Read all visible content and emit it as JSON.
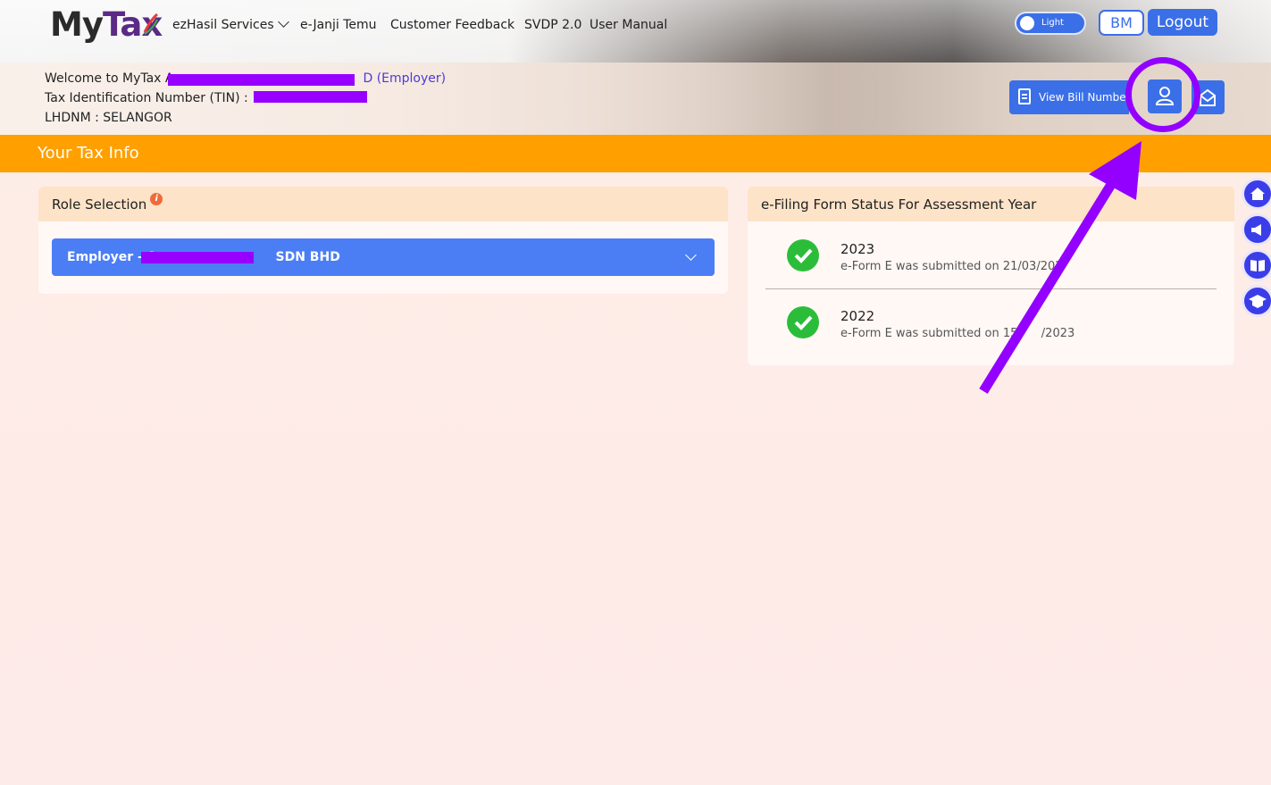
{
  "header": {
    "logo_text_1": "My",
    "logo_text_2": "Tax",
    "nav": [
      "ezHasil Services",
      "e-Janji Temu",
      "Customer Feedback",
      "SVDP 2.0",
      "User Manual"
    ],
    "theme_toggle_label": "Light",
    "lang_button": "BM",
    "logout_button": "Logout"
  },
  "welcome": {
    "line1_prefix": "Welcome to MyTax A",
    "line1_suffix": "D (Employer)",
    "line2": "Tax Identification Number (TIN) : ",
    "line3": "LHDNM : SELANGOR",
    "view_bill_button": "View Bill Number"
  },
  "section": {
    "title": "Your Tax Info"
  },
  "role_card": {
    "title": "Role Selection",
    "info_icon": "i",
    "selected_prefix": "Employer - A",
    "selected_suffix": "SDN BHD"
  },
  "efiling_card": {
    "title": "e-Filing Form Status For Assessment Year",
    "rows": [
      {
        "year": "2023",
        "desc": "e-Form E was submitted on 21/03/202"
      },
      {
        "year": "2022",
        "desc": "e-Form E was submitted on 15/"
      }
    ],
    "row2_desc_tail": "/2023"
  },
  "side_buttons": [
    "home-icon",
    "megaphone-icon",
    "book-icon",
    "graduation-cap-icon"
  ],
  "colors": {
    "accent_blue": "#3b6fe8",
    "section_orange": "#ff9f00",
    "annotation_purple": "#9300ff",
    "success_green": "#2bbd3a"
  }
}
